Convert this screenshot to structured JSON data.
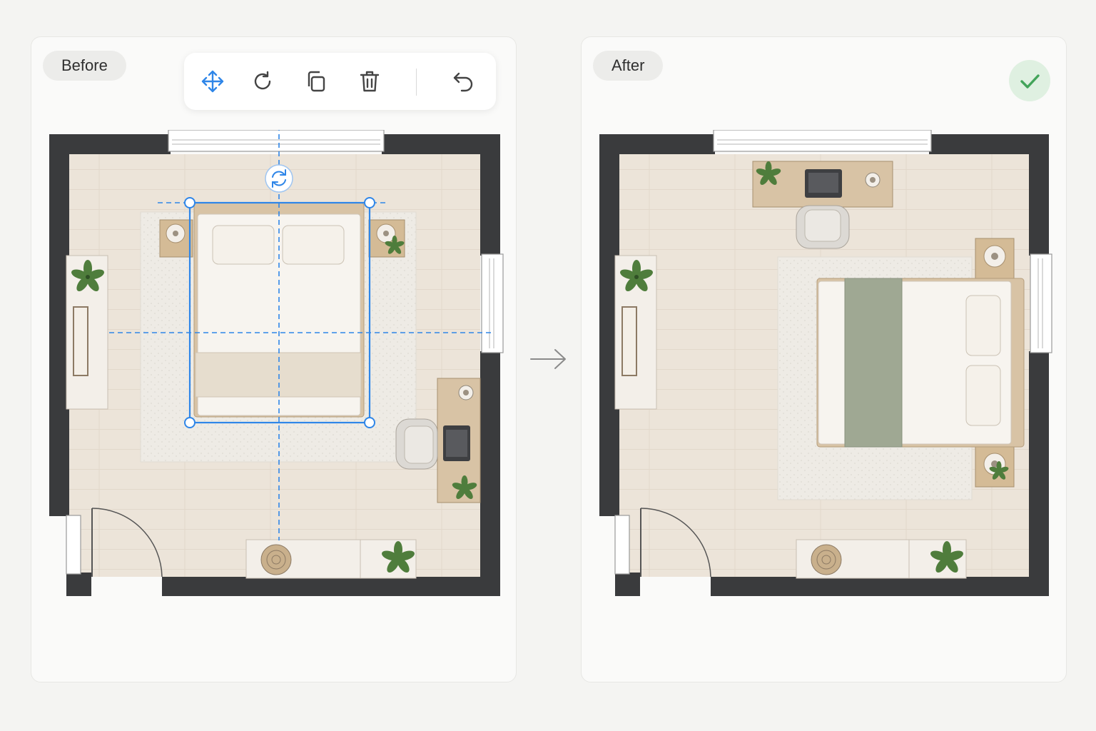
{
  "before_panel": {
    "label": "Before"
  },
  "after_panel": {
    "label": "After"
  },
  "toolbar": {
    "icons": [
      "move-icon",
      "rotate-icon",
      "duplicate-icon",
      "delete-icon",
      "undo-icon"
    ]
  },
  "colors": {
    "accent_blue": "#2f86e8",
    "wall": "#3a3b3d",
    "floor": "#ece4d9",
    "success_green": "#43a45a"
  }
}
